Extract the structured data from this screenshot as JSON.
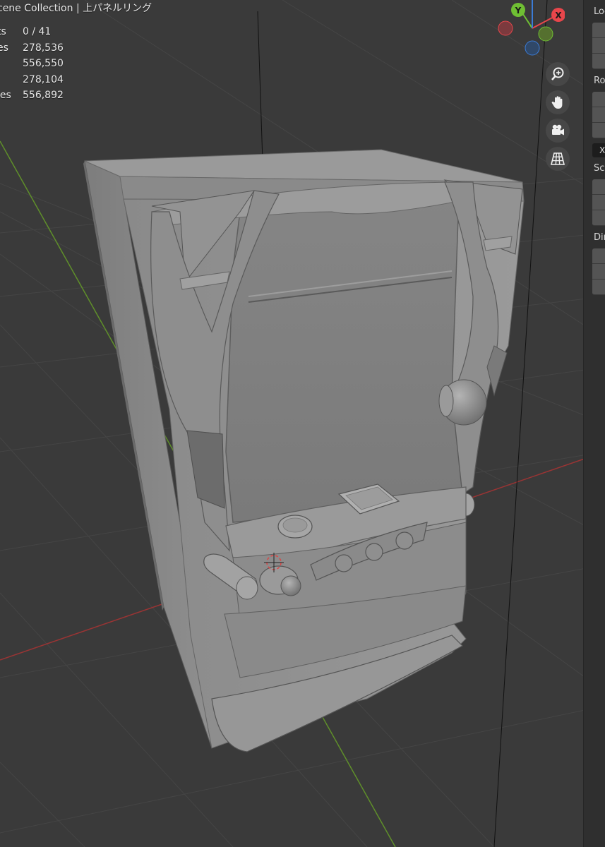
{
  "header": {
    "collection_path": "cene Collection | 上パネルリング"
  },
  "stats": [
    {
      "label": "ts",
      "value": "0 / 41"
    },
    {
      "label": "es",
      "value": "278,536"
    },
    {
      "label": "",
      "value": "556,550"
    },
    {
      "label": "",
      "value": "278,104"
    },
    {
      "label": "les",
      "value": "556,892"
    }
  ],
  "gizmo": {
    "y_label": "Y",
    "x_label": "X",
    "colors": {
      "x": "#e8464b",
      "y": "#6fbf33",
      "z": "#3b7bd6"
    }
  },
  "nav_buttons": [
    {
      "icon": "zoom-icon"
    },
    {
      "icon": "hand-pan-icon"
    },
    {
      "icon": "camera-icon"
    },
    {
      "icon": "grid-view-icon"
    }
  ],
  "n_panel": {
    "location_label": "Loc",
    "rotation_label": "Ro",
    "rotation_mode": "X",
    "scale_label": "Sca",
    "dimensions_label": "Dim"
  },
  "colors": {
    "viewport_bg": "#3a3a3a",
    "x_axis": "#b33a3a",
    "y_axis": "#6a9a2a",
    "model": "#8c8c8c"
  }
}
